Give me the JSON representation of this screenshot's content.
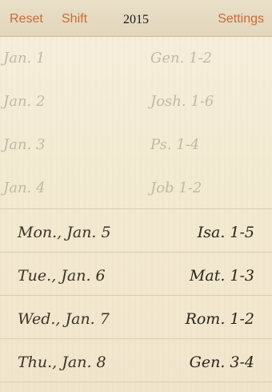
{
  "header": {
    "reset_label": "Reset",
    "shift_label": "Shift",
    "year": "2015",
    "settings_label": "Settings"
  },
  "completed": [
    {
      "date": "Jan. 1",
      "ref": "Gen. 1-2"
    },
    {
      "date": "Jan. 2",
      "ref": "Josh. 1-6"
    },
    {
      "date": "Jan. 3",
      "ref": "Ps. 1-4"
    },
    {
      "date": "Jan. 4",
      "ref": "Job 1-2"
    }
  ],
  "upcoming": [
    {
      "date": "Mon., Jan. 5",
      "ref": "Isa. 1-5"
    },
    {
      "date": "Tue., Jan. 6",
      "ref": "Mat. 1-3"
    },
    {
      "date": "Wed., Jan. 7",
      "ref": "Rom. 1-2"
    },
    {
      "date": "Thu., Jan. 8",
      "ref": "Gen. 3-4"
    }
  ],
  "colors": {
    "accent": "#c96a38",
    "background": "#f4ecd8",
    "header": "#e5dac0"
  }
}
